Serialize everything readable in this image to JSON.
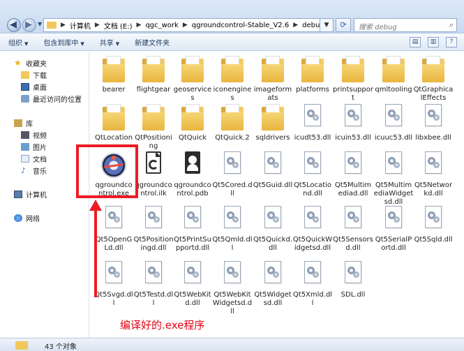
{
  "address": {
    "crumbs": [
      "计算机",
      "文档 (E:)",
      "qgc_work",
      "qgroundcontrol-Stable_V2.6",
      "debug"
    ],
    "search_placeholder": "搜索 debug"
  },
  "toolbar": {
    "organize": "组织",
    "include_library": "包含到库中",
    "share": "共享",
    "new_folder": "新建文件夹"
  },
  "nav": {
    "favorites": "收藏夹",
    "favorites_items": [
      "下载",
      "桌面",
      "最近访问的位置"
    ],
    "libraries": "库",
    "library_items": [
      "视频",
      "图片",
      "文档",
      "音乐"
    ],
    "computer": "计算机",
    "network": "网络"
  },
  "files": [
    {
      "name": "bearer",
      "type": "folder"
    },
    {
      "name": "flightgear",
      "type": "folder"
    },
    {
      "name": "geoservices",
      "type": "folder"
    },
    {
      "name": "iconengines",
      "type": "folder"
    },
    {
      "name": "imageformats",
      "type": "folder"
    },
    {
      "name": "platforms",
      "type": "folder"
    },
    {
      "name": "printsupport",
      "type": "folder"
    },
    {
      "name": "qmltooling",
      "type": "folder"
    },
    {
      "name": "QtGraphicalEffects",
      "type": "folder"
    },
    {
      "name": "QtLocation",
      "type": "folder"
    },
    {
      "name": "QtPositioning",
      "type": "folder"
    },
    {
      "name": "QtQuick",
      "type": "folder"
    },
    {
      "name": "QtQuick.2",
      "type": "folder"
    },
    {
      "name": "sqldrivers",
      "type": "folder"
    },
    {
      "name": "icudt53.dll",
      "type": "dll"
    },
    {
      "name": "icuin53.dll",
      "type": "dll"
    },
    {
      "name": "icuuc53.dll",
      "type": "dll"
    },
    {
      "name": "libxbee.dll",
      "type": "dll"
    },
    {
      "name": "qgroundcontrol.exe",
      "type": "exe"
    },
    {
      "name": "qgroundcontrol.ilk",
      "type": "ilk"
    },
    {
      "name": "qgroundcontrol.pdb",
      "type": "pdb"
    },
    {
      "name": "Qt5Cored.dll",
      "type": "dll"
    },
    {
      "name": "Qt5Guid.dll",
      "type": "dll"
    },
    {
      "name": "Qt5Locationd.dll",
      "type": "dll"
    },
    {
      "name": "Qt5Multimediad.dll",
      "type": "dll"
    },
    {
      "name": "Qt5MultimediaWidgetsd.dll",
      "type": "dll"
    },
    {
      "name": "Qt5Networkd.dll",
      "type": "dll"
    },
    {
      "name": "Qt5OpenGLd.dll",
      "type": "dll"
    },
    {
      "name": "Qt5Positioningd.dll",
      "type": "dll"
    },
    {
      "name": "Qt5PrintSupportd.dll",
      "type": "dll"
    },
    {
      "name": "Qt5Qmld.dll",
      "type": "dll"
    },
    {
      "name": "Qt5Quickd.dll",
      "type": "dll"
    },
    {
      "name": "Qt5QuickWidgetsd.dll",
      "type": "dll"
    },
    {
      "name": "Qt5Sensorsd.dll",
      "type": "dll"
    },
    {
      "name": "Qt5SerialPortd.dll",
      "type": "dll"
    },
    {
      "name": "Qt5Sqld.dll",
      "type": "dll"
    },
    {
      "name": "Qt5Svgd.dll",
      "type": "dll"
    },
    {
      "name": "Qt5Testd.dll",
      "type": "dll"
    },
    {
      "name": "Qt5WebKitd.dll",
      "type": "dll"
    },
    {
      "name": "Qt5WebKitWidgetsd.dll",
      "type": "dll"
    },
    {
      "name": "Qt5Widgetsd.dll",
      "type": "dll"
    },
    {
      "name": "Qt5Xmld.dll",
      "type": "dll"
    },
    {
      "name": "SDL.dll",
      "type": "dll"
    }
  ],
  "annotation": "编译好的.exe程序",
  "status": "43 个对象"
}
